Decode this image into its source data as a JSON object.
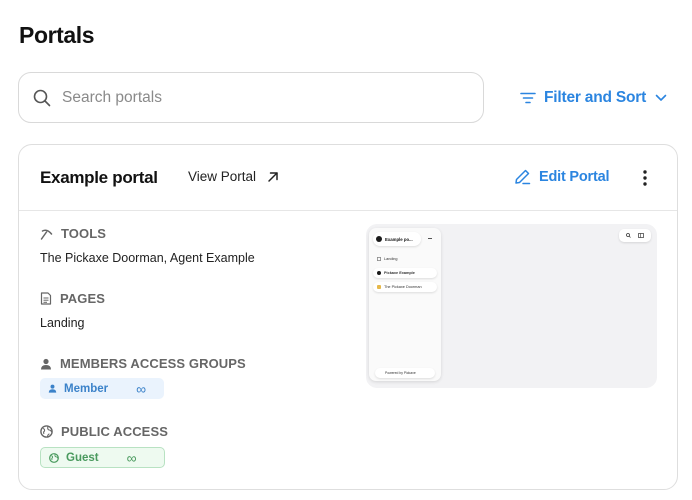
{
  "page": {
    "title": "Portals"
  },
  "search": {
    "placeholder": "Search portals",
    "value": ""
  },
  "filter": {
    "label": "Filter and Sort"
  },
  "portal": {
    "name": "Example portal",
    "view_label": "View Portal",
    "edit_label": "Edit Portal",
    "tools": {
      "heading": "TOOLS",
      "value": "The Pickaxe Doorman, Agent Example"
    },
    "pages": {
      "heading": "PAGES",
      "value": "Landing"
    },
    "members": {
      "heading": "MEMBERS ACCESS GROUPS",
      "badge": "Member",
      "badge_limit": "∞"
    },
    "public": {
      "heading": "PUBLIC ACCESS",
      "badge": "Guest",
      "badge_limit": "∞"
    },
    "preview": {
      "title": "Example po...",
      "items": [
        "Landing",
        "Pickaxe Example",
        "The Pickaxe Doorman"
      ],
      "footer": "Powered by Pickaxe"
    }
  },
  "colors": {
    "accent": "#2b85e0",
    "member_bg": "#eaf3fd",
    "guest_bg": "#eefaf0",
    "guest_text": "#4a9a5e"
  },
  "icons": [
    "search-icon",
    "filter-icon",
    "chevron-down-icon",
    "arrow-up-right-icon",
    "pencil-icon",
    "more-vertical-icon",
    "pickaxe-icon",
    "document-icon",
    "person-icon",
    "globe-icon",
    "infinity-icon"
  ]
}
